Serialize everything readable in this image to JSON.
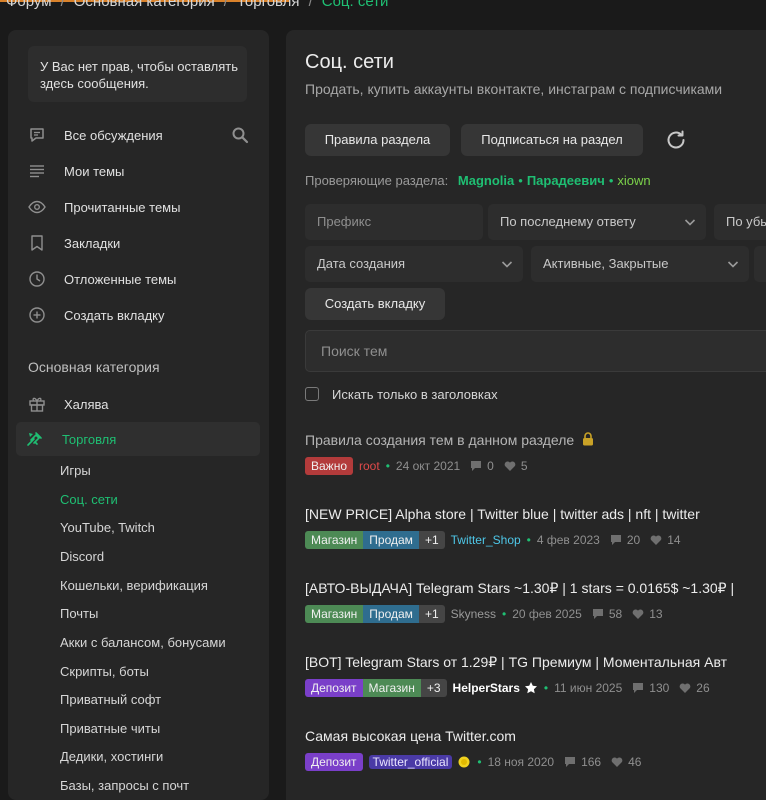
{
  "breadcrumb": {
    "items": [
      "Форум",
      "Основная категория",
      "Торговля"
    ],
    "current": "Соц. сети",
    "separator": "/"
  },
  "sidebar": {
    "notice": "У Вас нет прав, чтобы оставлять здесь сообщения.",
    "nav": [
      {
        "label": "Все обсуждения",
        "icon": "chat-icon"
      },
      {
        "label": "Мои темы",
        "icon": "list-icon"
      },
      {
        "label": "Прочитанные темы",
        "icon": "eye-icon"
      },
      {
        "label": "Закладки",
        "icon": "bookmark-icon"
      },
      {
        "label": "Отложенные темы",
        "icon": "clock-icon"
      },
      {
        "label": "Создать вкладку",
        "icon": "plus-circle-icon"
      }
    ],
    "section_title": "Основная категория",
    "categories": [
      {
        "label": "Халява",
        "icon": "gift-icon"
      },
      {
        "label": "Торговля",
        "icon": "trade-icon"
      }
    ],
    "subcategories": [
      "Игры",
      "Соц. сети",
      "YouTube, Twitch",
      "Discord",
      "Кошельки, верификация",
      "Почты",
      "Акки с балансом, бонусами",
      "Скрипты, боты",
      "Приватный софт",
      "Приватные читы",
      "Дедики, хостинги",
      "Базы, запросы с почт"
    ],
    "active_sub": "Соц. сети"
  },
  "main": {
    "title": "Соц. сети",
    "description": "Продать, купить аккаунты вконтакте, инстаграм с подписчиками",
    "rules_button": "Правила раздела",
    "subscribe_button": "Подписаться на раздел",
    "moderators_label": "Проверяющие раздела:",
    "moderators": [
      "Magnolia",
      "Парадеевич",
      "xiown"
    ],
    "filters": {
      "prefix_placeholder": "Префикс",
      "sort": "По последнему ответу",
      "order": "По убы",
      "date": "Дата создания",
      "state": "Активные, Закрытые"
    },
    "create_tab_button": "Создать вкладку",
    "search_placeholder": "Поиск тем",
    "titles_only_label": "Искать только в заголовках",
    "threads": [
      {
        "title": "Правила создания тем в данном разделе",
        "tags": [
          "Важно"
        ],
        "author": "root",
        "date": "24 окт 2021",
        "replies": "0",
        "likes": "5"
      },
      {
        "title": "[NEW PRICE] Alpha store | Twitter blue | twitter ads | nft | twitter",
        "tags": [
          "Магазин",
          "Продам",
          "+1"
        ],
        "author": "Twitter_Shop",
        "date": "4 фев 2023",
        "replies": "20",
        "likes": "14"
      },
      {
        "title": "[АВТО-ВЫДАЧА] Telegram Stars ~1.30₽ | 1 stars = 0.0165$ ~1.30₽ |",
        "tags": [
          "Магазин",
          "Продам",
          "+1"
        ],
        "author": "Skyness",
        "date": "20 фев 2025",
        "replies": "58",
        "likes": "13"
      },
      {
        "title": "[BOT] Telegram Stars от 1.29₽ | TG Премиум | Моментальная Авт",
        "tags": [
          "Депозит",
          "Магазин",
          "+3"
        ],
        "author": "HelperStars",
        "date": "11 июн 2025",
        "replies": "130",
        "likes": "26"
      },
      {
        "title": "Самая высокая цена Twitter.com",
        "tags": [
          "Депозит"
        ],
        "author": "Twitter_official",
        "date": "18 ноя 2020",
        "replies": "166",
        "likes": "46"
      }
    ]
  },
  "colors": {
    "accent": "#1fbf73",
    "background": "#1a1a1a",
    "panel": "#262626"
  }
}
